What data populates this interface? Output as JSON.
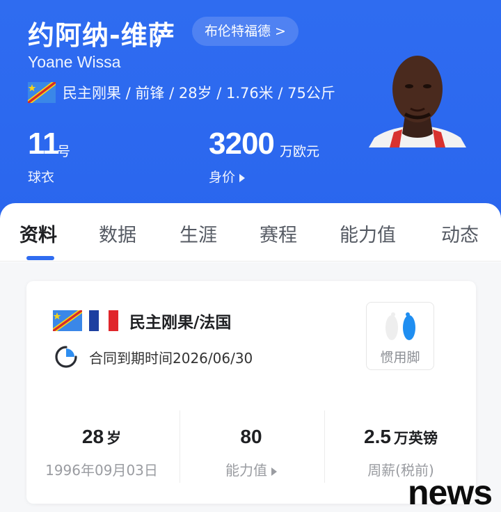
{
  "player": {
    "name_cn": "约阿纳-维萨",
    "name_en": "Yoane Wissa",
    "club_link": "布伦特福德 >",
    "info_line": "民主刚果 / 前锋 / 28岁 / 1.76米 / 75公斤",
    "flag": "drc-flag-icon"
  },
  "header_stats": {
    "number": "11",
    "number_unit": "号",
    "number_label": "球衣",
    "value": "3200",
    "value_unit": "万欧元",
    "value_label": "身价"
  },
  "tabs": [
    {
      "label": "资料",
      "active": true
    },
    {
      "label": "数据",
      "active": false
    },
    {
      "label": "生涯",
      "active": false
    },
    {
      "label": "赛程",
      "active": false
    },
    {
      "label": "能力值",
      "active": false
    },
    {
      "label": "动态",
      "active": false
    }
  ],
  "card": {
    "nationality": "民主刚果/法国",
    "contract": "合同到期时间2026/06/30",
    "preferred_foot_label": "惯用脚",
    "preferred_foot": "right",
    "stats": [
      {
        "value": "28",
        "unit": "岁",
        "label": "1996年09月03日"
      },
      {
        "value": "80",
        "unit": "",
        "label": "能力值"
      },
      {
        "value": "2.5",
        "unit": "万英镑",
        "label": "周薪(税前)"
      }
    ]
  },
  "watermark": "news",
  "colors": {
    "header_blue": "#2f6cf0",
    "tab_indicator": "#2f6cf0",
    "foot_active": "#1f8ef1"
  }
}
